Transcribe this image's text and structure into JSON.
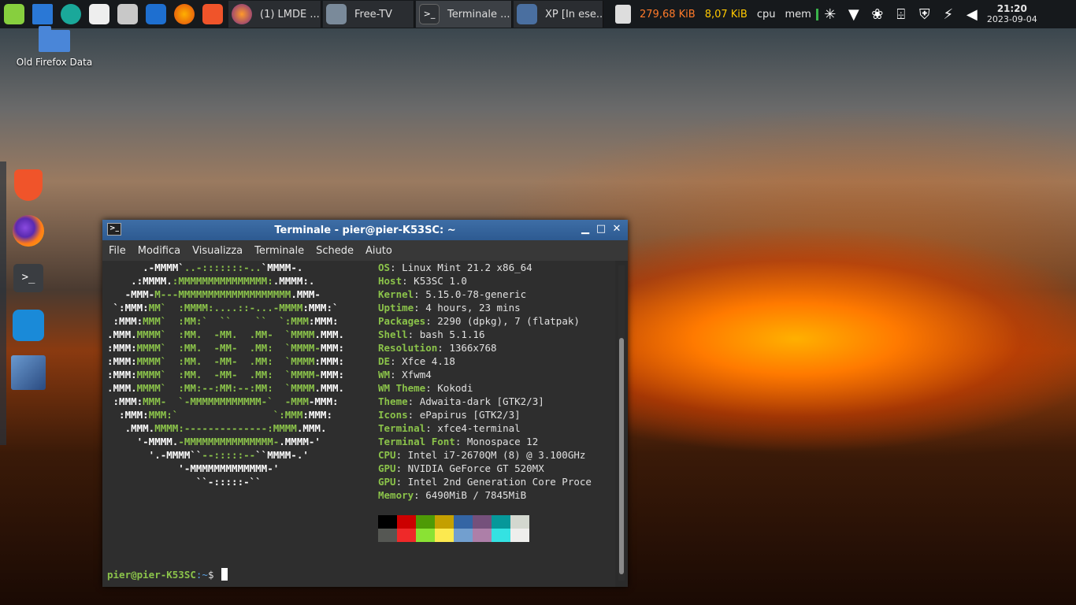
{
  "panel": {
    "tasks": [
      {
        "label": "(1) LMDE ...",
        "icon": "firefox-icon"
      },
      {
        "label": "Free-TV",
        "icon": "free-tv-icon"
      },
      {
        "label": "Terminale ...",
        "icon": "terminal-icon"
      },
      {
        "label": "XP [In ese...",
        "icon": "virtualbox-xp-icon"
      }
    ],
    "monitors": {
      "net_down": "279,68 KiB",
      "net_up": "8,07 KiB",
      "cpu": "cpu",
      "mem": "mem"
    },
    "clock": {
      "time": "21:20",
      "date": "2023-09-04"
    }
  },
  "desktop": {
    "icon_label": "Old Firefox Data"
  },
  "window": {
    "title": "Terminale - pier@pier-K53SC: ~",
    "menu": [
      "File",
      "Modifica",
      "Visualizza",
      "Terminale",
      "Schede",
      "Aiuto"
    ]
  },
  "neofetch": {
    "info": [
      {
        "key": "OS",
        "value": "Linux Mint 21.2 x86_64"
      },
      {
        "key": "Host",
        "value": "K53SC 1.0"
      },
      {
        "key": "Kernel",
        "value": "5.15.0-78-generic"
      },
      {
        "key": "Uptime",
        "value": "4 hours, 23 mins"
      },
      {
        "key": "Packages",
        "value": "2290 (dpkg), 7 (flatpak)"
      },
      {
        "key": "Shell",
        "value": "bash 5.1.16"
      },
      {
        "key": "Resolution",
        "value": "1366x768"
      },
      {
        "key": "DE",
        "value": "Xfce 4.18"
      },
      {
        "key": "WM",
        "value": "Xfwm4"
      },
      {
        "key": "WM Theme",
        "value": "Kokodi"
      },
      {
        "key": "Theme",
        "value": "Adwaita-dark [GTK2/3]"
      },
      {
        "key": "Icons",
        "value": "ePapirus [GTK2/3]"
      },
      {
        "key": "Terminal",
        "value": "xfce4-terminal"
      },
      {
        "key": "Terminal Font",
        "value": "Monospace 12"
      },
      {
        "key": "CPU",
        "value": "Intel i7-2670QM (8) @ 3.100GHz"
      },
      {
        "key": "GPU",
        "value": "NVIDIA GeForce GT 520MX"
      },
      {
        "key": "GPU",
        "value": "Intel 2nd Generation Core Proce"
      },
      {
        "key": "Memory",
        "value": "6490MiB / 7845MiB"
      }
    ],
    "palette": [
      "#000000",
      "#cc0000",
      "#4e9a06",
      "#c4a000",
      "#3465a4",
      "#75507b",
      "#06989a",
      "#d3d7cf",
      "#555753",
      "#ef2929",
      "#8ae234",
      "#fce94f",
      "#729fcf",
      "#ad7fa8",
      "#34e2e2",
      "#eeeeec"
    ]
  },
  "prompt": {
    "user": "pier@pier-K53SC",
    "path": ":~",
    "symbol": "$ "
  }
}
